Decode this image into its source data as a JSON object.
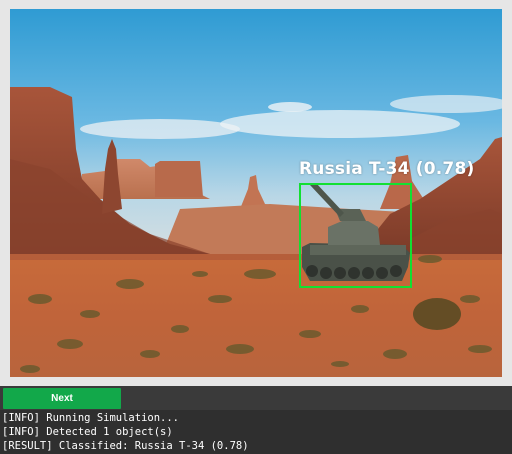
{
  "detection": {
    "label": "Russia T-34 (0.78)",
    "box_color": "#12e032"
  },
  "controls": {
    "next_label": "Next",
    "accent": "#12a84a"
  },
  "console": {
    "lines": [
      "[INFO] Running Simulation...",
      "[INFO] Detected 1 object(s)",
      "[RESULT] Classified: Russia T-34 (0.78)"
    ]
  }
}
